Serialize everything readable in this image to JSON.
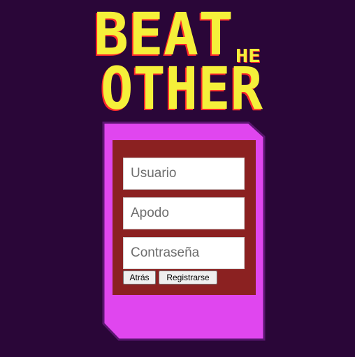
{
  "logo": {
    "line1": "BEAT",
    "small": "HE",
    "line2": "OTHER"
  },
  "form": {
    "username_placeholder": "Usuario",
    "nickname_placeholder": "Apodo",
    "password_placeholder": "Contraseña",
    "back_label": "Atrás",
    "register_label": "Registrarse"
  },
  "colors": {
    "background": "#2a0638",
    "card": "#e046ef",
    "card_border": "#5a1670",
    "panel": "#8b2121",
    "logo_fill": "#f5f03a",
    "logo_shadow": "#ff2a2a"
  }
}
